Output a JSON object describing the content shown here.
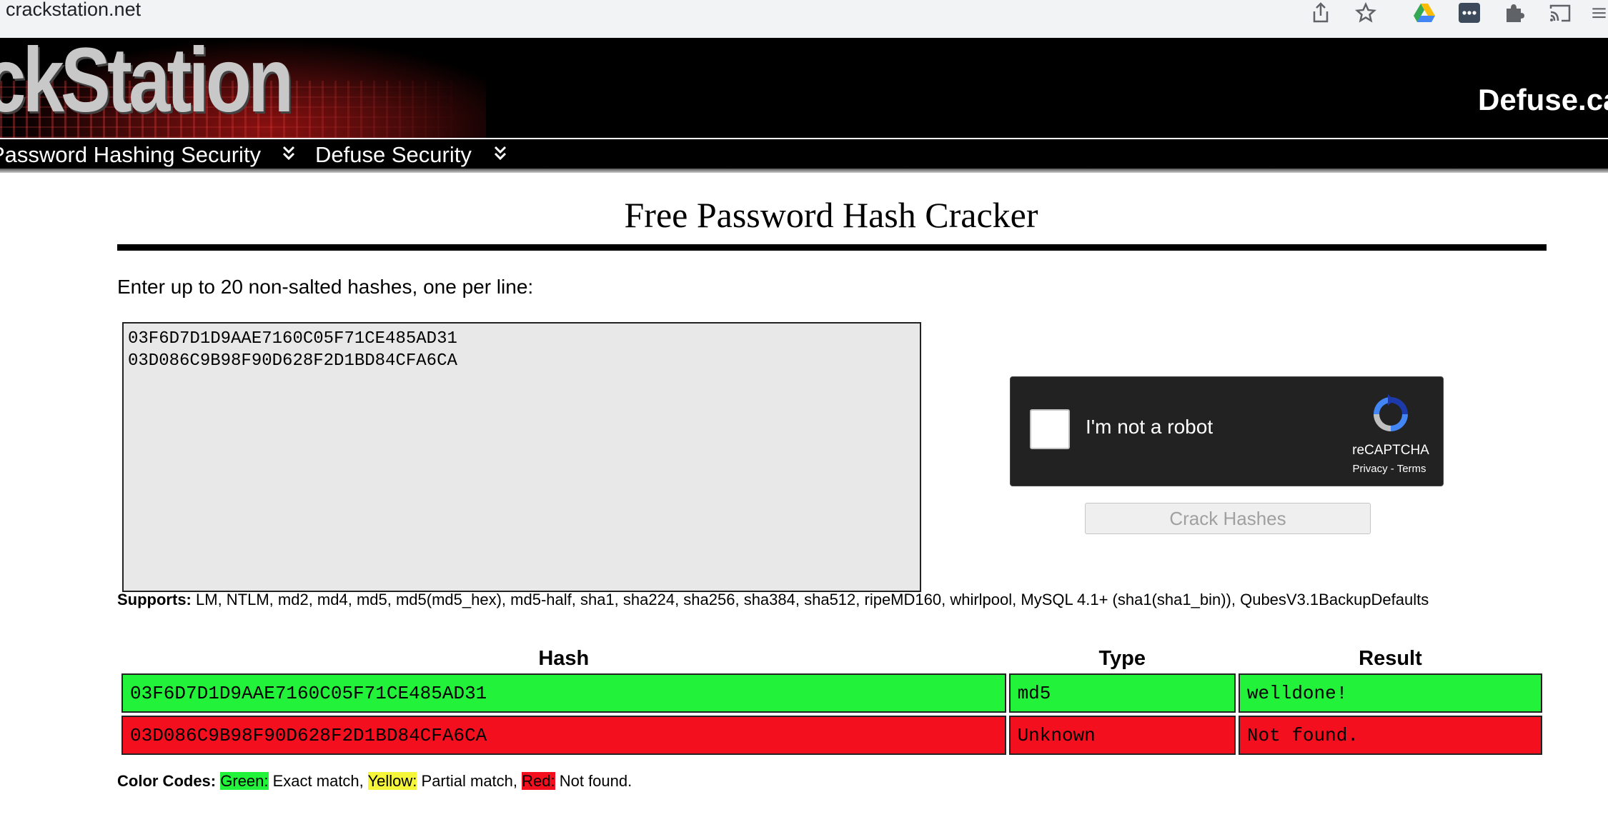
{
  "browser": {
    "url": "crackstation.net",
    "icons": [
      "share-icon",
      "star-icon",
      "google-drive-icon",
      "extension-dots-icon",
      "puzzle-icon",
      "cast-icon",
      "menu-icon"
    ]
  },
  "header": {
    "logo": "ckStation",
    "site_link": "Defuse.ca",
    "nav": [
      "Password Hashing Security",
      "Defuse Security"
    ]
  },
  "main": {
    "title": "Free Password Hash Cracker",
    "instructions": "Enter up to 20 non-salted hashes, one per line:",
    "hash_input": "03F6D7D1D9AAE7160C05F71CE485AD31\n03D086C9B98F90D628F2D1BD84CFA6CA",
    "captcha": {
      "label": "I'm not a robot",
      "brand": "reCAPTCHA",
      "privacy": "Privacy",
      "separator": " - ",
      "terms": "Terms"
    },
    "crack_button": "Crack Hashes",
    "supports_label": "Supports:",
    "supports_text": " LM, NTLM, md2, md4, md5, md5(md5_hex), md5-half, sha1, sha224, sha256, sha384, sha512, ripeMD160, whirlpool, MySQL 4.1+ (sha1(sha1_bin)), QubesV3.1BackupDefaults"
  },
  "results": {
    "headers": [
      "Hash",
      "Type",
      "Result"
    ],
    "rows": [
      {
        "hash": "03F6D7D1D9AAE7160C05F71CE485AD31",
        "type": "md5",
        "result": "welldone!",
        "status": "green"
      },
      {
        "hash": "03D086C9B98F90D628F2D1BD84CFA6CA",
        "type": "Unknown",
        "result": "Not found.",
        "status": "red"
      }
    ]
  },
  "color_codes": {
    "label": "Color Codes:",
    "green": "Green:",
    "green_desc": " Exact match, ",
    "yellow": "Yellow:",
    "yellow_desc": " Partial match, ",
    "red": "Red:",
    "red_desc": " Not found."
  },
  "colors": {
    "green": "#22f23a",
    "yellow": "#f5f53a",
    "red": "#f40f1e"
  }
}
